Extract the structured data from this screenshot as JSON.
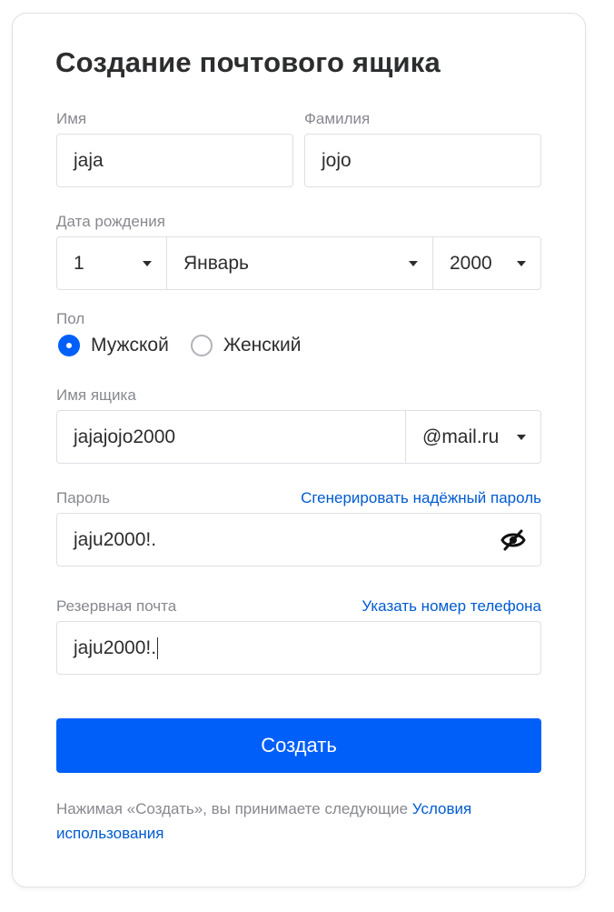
{
  "form": {
    "title": "Создание почтового ящика",
    "first_name": {
      "label": "Имя",
      "value": "jaja"
    },
    "last_name": {
      "label": "Фамилия",
      "value": "jojo"
    },
    "birth_date": {
      "label": "Дата рождения",
      "day": "1",
      "month": "Январь",
      "year": "2000"
    },
    "gender": {
      "label": "Пол",
      "options": [
        "Мужской",
        "Женский"
      ],
      "selected": "Мужской"
    },
    "mailbox": {
      "label": "Имя ящика",
      "value": "jajajojo2000",
      "domain": "@mail.ru"
    },
    "password": {
      "label": "Пароль",
      "generate_link": "Сгенерировать надёжный пароль",
      "value": "jaju2000!.",
      "toggle_icon": "eye-slash-icon"
    },
    "backup_email": {
      "label": "Резервная почта",
      "phone_link": "Указать номер телефона",
      "value": "jaju2000!."
    },
    "submit_label": "Создать",
    "terms_text": "Нажимая «Создать», вы принимаете следующие ",
    "terms_link": "Условия использования"
  },
  "colors": {
    "accent": "#005ff9",
    "link": "#005bd1",
    "label": "#87898f",
    "text": "#2c2d2e",
    "border": "#dfe0e4"
  }
}
